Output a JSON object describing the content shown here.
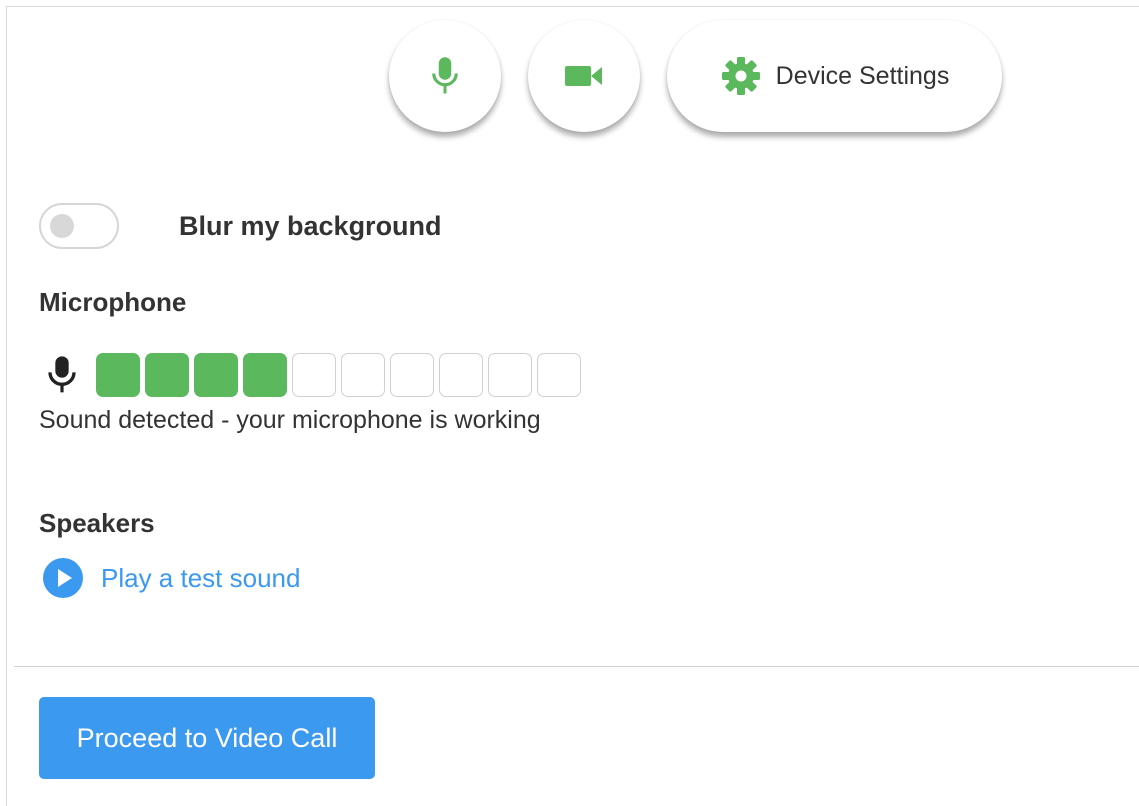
{
  "toolbar": {
    "mic_icon": "microphone-icon",
    "camera_icon": "video-camera-icon",
    "settings_icon": "gear-icon",
    "device_settings_label": "Device Settings"
  },
  "background": {
    "blur_label": "Blur my background",
    "blur_enabled": false
  },
  "microphone": {
    "title": "Microphone",
    "level_active": 4,
    "level_total": 10,
    "status": "Sound detected - your microphone is working"
  },
  "speakers": {
    "title": "Speakers",
    "test_sound_label": "Play a test sound"
  },
  "footer": {
    "proceed_label": "Proceed to Video Call"
  },
  "colors": {
    "green": "#5cb85c",
    "blue": "#3b99f0"
  }
}
